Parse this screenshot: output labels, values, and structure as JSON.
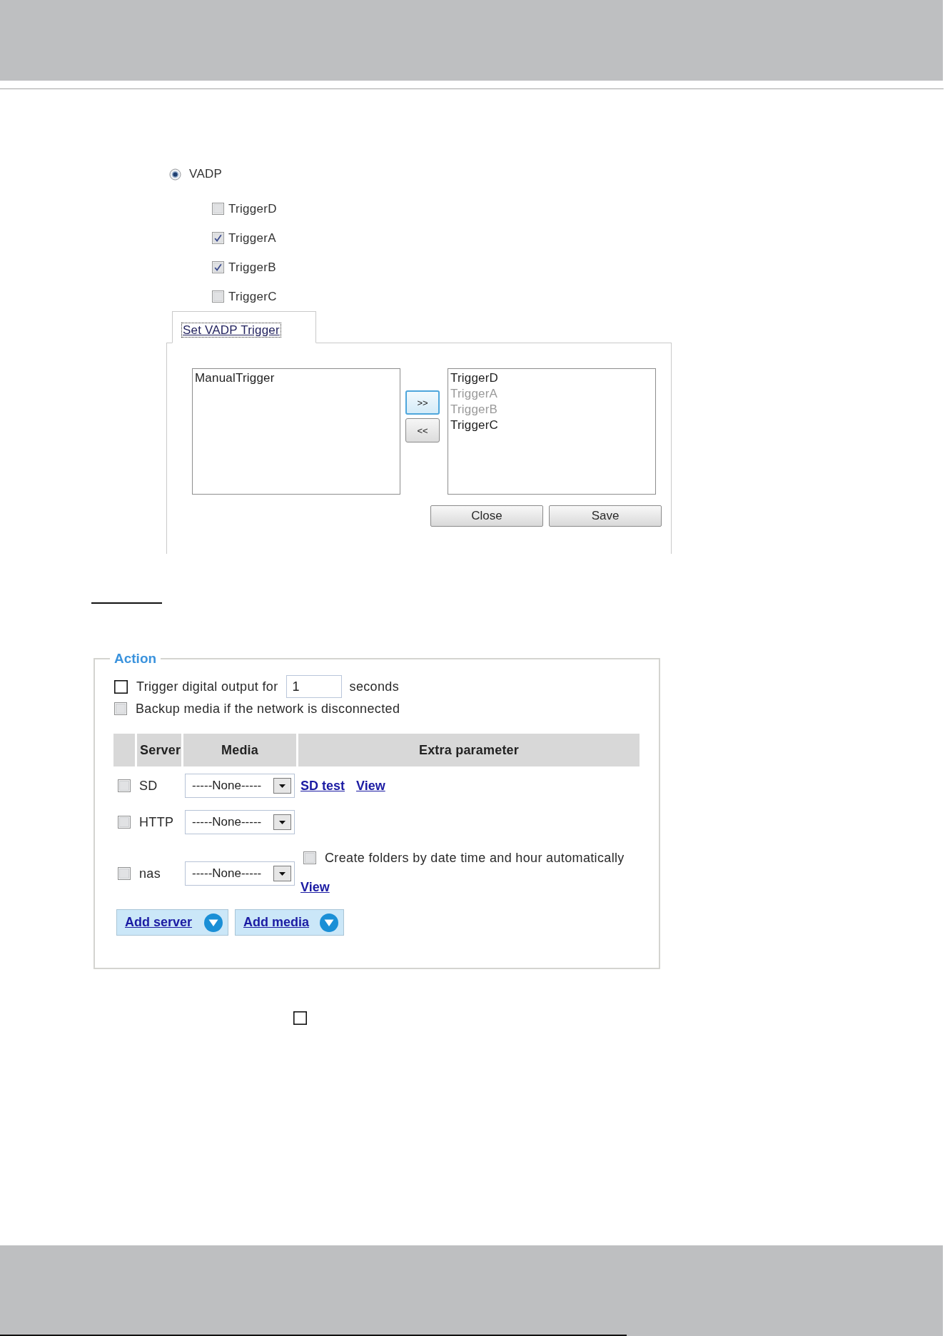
{
  "vadp": {
    "label": "VADP",
    "selected": true
  },
  "triggers": [
    {
      "label": "TriggerD",
      "checked": false
    },
    {
      "label": "TriggerA",
      "checked": true
    },
    {
      "label": "TriggerB",
      "checked": true
    },
    {
      "label": "TriggerC",
      "checked": false
    }
  ],
  "trigger_dialog": {
    "tab": {
      "label": "Set VADP Trigger",
      "selected": true
    },
    "left_list": [
      "ManualTrigger"
    ],
    "move_buttons": [
      {
        "label": ">>",
        "focused": true
      },
      {
        "label": "<<",
        "focused": false
      }
    ],
    "right_list": [
      {
        "label": "TriggerD",
        "disabled": false
      },
      {
        "label": "TriggerA",
        "disabled": true
      },
      {
        "label": "TriggerB",
        "disabled": true
      },
      {
        "label": "TriggerC",
        "disabled": false
      }
    ],
    "buttons": [
      "Close",
      "Save"
    ]
  },
  "action": {
    "legend": "Action",
    "digital_output": {
      "checked": false,
      "label": "Trigger digital output for",
      "value": "1",
      "unit": "seconds"
    },
    "backup": {
      "checked": false,
      "label": "Backup media if the network is disconnected"
    },
    "table": {
      "columns": [
        "Server",
        "Media",
        "Extra parameter"
      ],
      "rows": [
        {
          "checked": false,
          "server": "SD",
          "media": "-----None-----",
          "extra": [
            {
              "kind": "link",
              "text": "SD test"
            },
            {
              "kind": "link",
              "text": "View"
            }
          ]
        },
        {
          "checked": false,
          "server": "HTTP",
          "media": "-----None-----"
        },
        {
          "checked": false,
          "server": "nas",
          "media": "-----None-----",
          "extra": [
            {
              "kind": "checkbox",
              "text": "Create folders by date time and hour automatically",
              "checked": false
            },
            {
              "kind": "link",
              "text": "View"
            }
          ]
        }
      ]
    },
    "add_buttons": [
      "Add server",
      "Add media"
    ]
  },
  "standalone_checkbox": {
    "checked": false
  }
}
